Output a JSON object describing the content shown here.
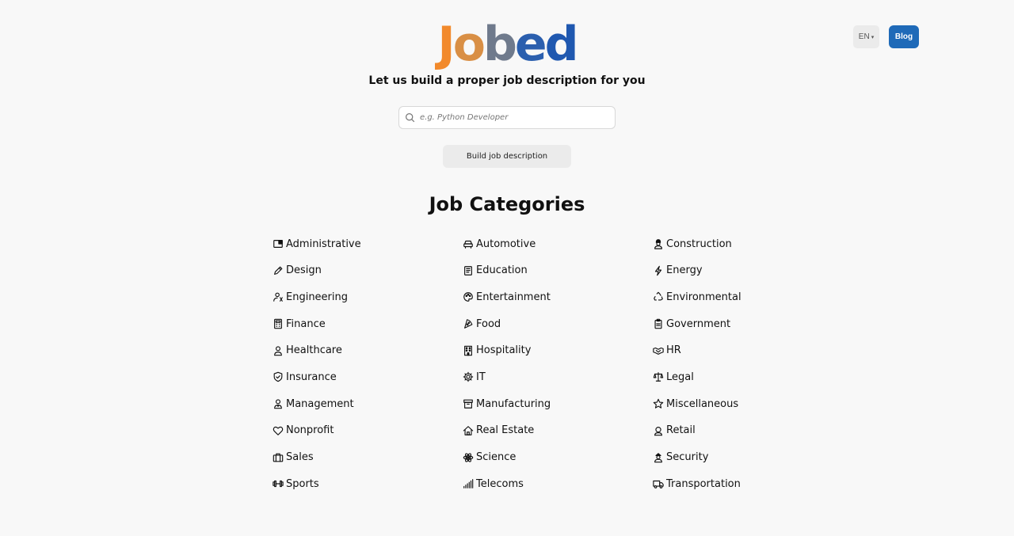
{
  "header": {
    "language_label": "EN",
    "blog_label": "Blog"
  },
  "logo": {
    "letters": [
      "J",
      "o",
      "b",
      "e",
      "d"
    ]
  },
  "tagline": "Let us build a proper job description for you",
  "search": {
    "placeholder": "e.g. Python Developer",
    "value": ""
  },
  "build_button_label": "Build job description",
  "categories_title": "Job Categories",
  "categories": [
    {
      "label": "Administrative",
      "icon": "folder-icon"
    },
    {
      "label": "Automotive",
      "icon": "car-icon"
    },
    {
      "label": "Construction",
      "icon": "worker-icon"
    },
    {
      "label": "Design",
      "icon": "pencil-icon"
    },
    {
      "label": "Education",
      "icon": "book-icon"
    },
    {
      "label": "Energy",
      "icon": "lightning-icon"
    },
    {
      "label": "Engineering",
      "icon": "engineer-icon"
    },
    {
      "label": "Entertainment",
      "icon": "palette-icon"
    },
    {
      "label": "Environmental",
      "icon": "recycle-icon"
    },
    {
      "label": "Finance",
      "icon": "calculator-icon"
    },
    {
      "label": "Food",
      "icon": "pizza-icon"
    },
    {
      "label": "Government",
      "icon": "clipboard-icon"
    },
    {
      "label": "Healthcare",
      "icon": "doctor-icon"
    },
    {
      "label": "Hospitality",
      "icon": "building-icon"
    },
    {
      "label": "HR",
      "icon": "handshake-icon"
    },
    {
      "label": "Insurance",
      "icon": "shield-icon"
    },
    {
      "label": "IT",
      "icon": "gear-icon"
    },
    {
      "label": "Legal",
      "icon": "scale-icon"
    },
    {
      "label": "Management",
      "icon": "manager-icon"
    },
    {
      "label": "Manufacturing",
      "icon": "archive-icon"
    },
    {
      "label": "Miscellaneous",
      "icon": "star-icon"
    },
    {
      "label": "Nonprofit",
      "icon": "heart-icon"
    },
    {
      "label": "Real Estate",
      "icon": "house-icon"
    },
    {
      "label": "Retail",
      "icon": "headset-icon"
    },
    {
      "label": "Sales",
      "icon": "briefcase-icon"
    },
    {
      "label": "Science",
      "icon": "atom-icon"
    },
    {
      "label": "Security",
      "icon": "guard-icon"
    },
    {
      "label": "Sports",
      "icon": "dumbbell-icon"
    },
    {
      "label": "Telecoms",
      "icon": "signal-icon"
    },
    {
      "label": "Transportation",
      "icon": "truck-icon"
    }
  ],
  "colors": {
    "logo_orange": "#f28a2c",
    "logo_blue": "#1f58b0",
    "blog_button": "#1f6ab8",
    "background": "#f8f8f8"
  }
}
